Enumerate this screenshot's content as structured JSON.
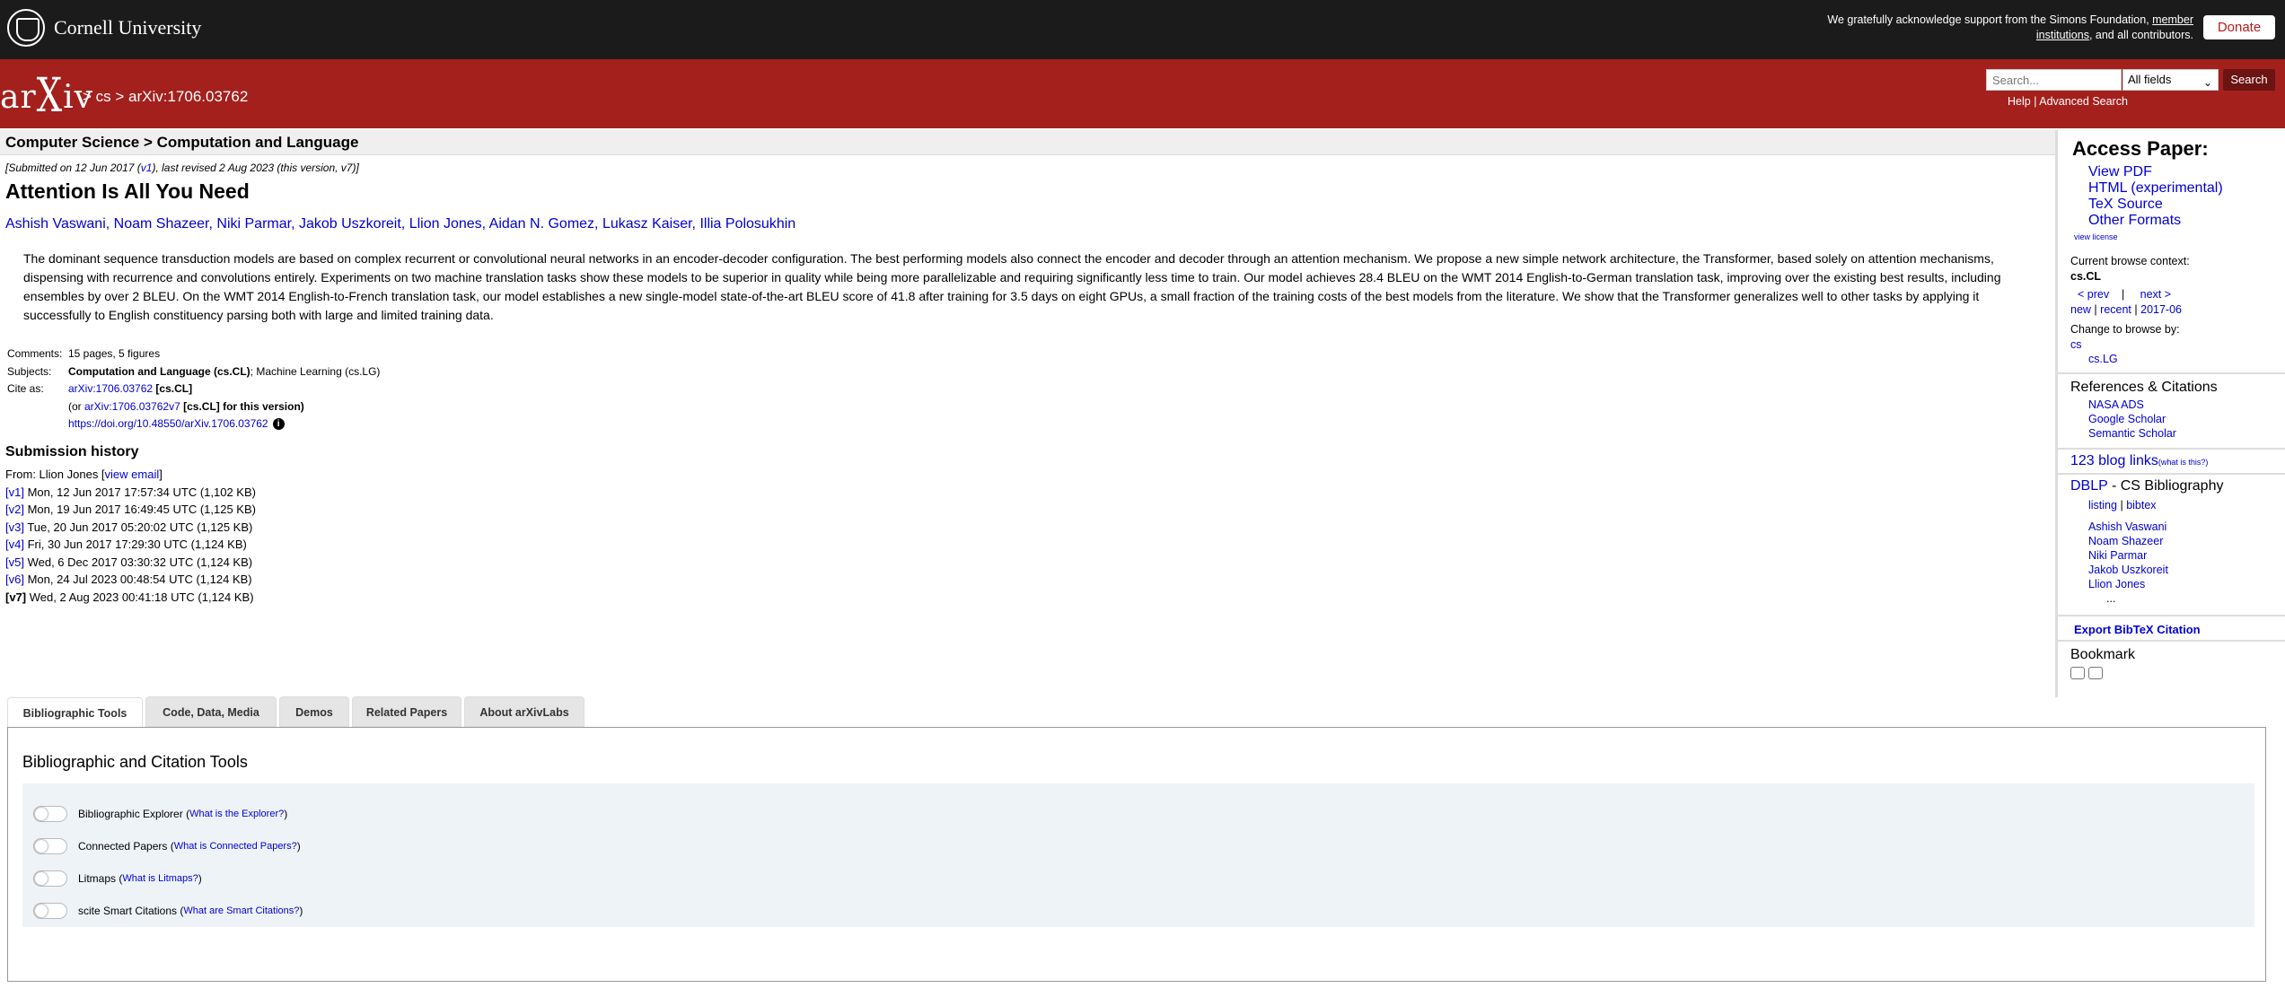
{
  "top": {
    "institution": "Cornell University",
    "support_prefix": "We gratefully acknowledge support from the Simons Foundation, ",
    "support_link": "member institutions",
    "support_suffix": ", and all contributors.",
    "donate_label": "Donate"
  },
  "header": {
    "logo_a": "ar",
    "logo_x": "X",
    "logo_b": "iv",
    "breadcrumb": "> cs > arXiv:1706.03762",
    "search_placeholder": "Search...",
    "search_field": "All fields",
    "search_button": "Search",
    "help": "Help",
    "separator": "|",
    "advanced": "Advanced Search"
  },
  "paper": {
    "category": "Computer Science > Computation and Language",
    "submitted_a": "[Submitted on 12 Jun 2017 (",
    "submitted_v1": "v1",
    "submitted_b": "), last revised 2 Aug 2023 (this version, v7)]",
    "title": "Attention Is All You Need",
    "authors": [
      "Ashish Vaswani",
      "Noam Shazeer",
      "Niki Parmar",
      "Jakob Uszkoreit",
      "Llion Jones",
      "Aidan N. Gomez",
      "Lukasz Kaiser",
      "Illia Polosukhin"
    ],
    "abstract": "The dominant sequence transduction models are based on complex recurrent or convolutional neural networks in an encoder-decoder configuration. The best performing models also connect the encoder and decoder through an attention mechanism. We propose a new simple network architecture, the Transformer, based solely on attention mechanisms, dispensing with recurrence and convolutions entirely. Experiments on two machine translation tasks show these models to be superior in quality while being more parallelizable and requiring significantly less time to train. Our model achieves 28.4 BLEU on the WMT 2014 English-to-German translation task, improving over the existing best results, including ensembles by over 2 BLEU. On the WMT 2014 English-to-French translation task, our model establishes a new single-model state-of-the-art BLEU score of 41.8 after training for 3.5 days on eight GPUs, a small fraction of the training costs of the best models from the literature. We show that the Transformer generalizes well to other tasks by applying it successfully to English constituency parsing both with large and limited training data.",
    "comments_label": "Comments:",
    "comments": "15 pages, 5 figures",
    "subjects_label": "Subjects:",
    "subjects_primary": "Computation and Language (cs.CL)",
    "subjects_rest": "; Machine Learning (cs.LG)",
    "cite_label": "Cite as:",
    "cite_id": "arXiv:1706.03762",
    "cite_cat": "[cs.CL]",
    "cite_or": "(or ",
    "cite_version": "arXiv:1706.03762v7",
    "cite_version_tail": "[cs.CL] for this version)",
    "doi": "https://doi.org/10.48550/arXiv.1706.03762",
    "info_glyph": "i"
  },
  "history": {
    "title": "Submission history",
    "from": "From: Llion Jones [",
    "view_email": "view email",
    "from_close": "]",
    "versions": [
      {
        "v": "[v1]",
        "text": " Mon, 12 Jun 2017 17:57:34 UTC (1,102 KB)"
      },
      {
        "v": "[v2]",
        "text": " Mon, 19 Jun 2017 16:49:45 UTC (1,125 KB)"
      },
      {
        "v": "[v3]",
        "text": " Tue, 20 Jun 2017 05:20:02 UTC (1,125 KB)"
      },
      {
        "v": "[v4]",
        "text": " Fri, 30 Jun 2017 17:29:30 UTC (1,124 KB)"
      },
      {
        "v": "[v5]",
        "text": " Wed, 6 Dec 2017 03:30:32 UTC (1,124 KB)"
      },
      {
        "v": "[v6]",
        "text": " Mon, 24 Jul 2023 00:48:54 UTC (1,124 KB)"
      },
      {
        "v": "[v7]",
        "text": " Wed, 2 Aug 2023 00:41:18 UTC (1,124 KB)"
      }
    ]
  },
  "sidebar": {
    "access_title": "Access Paper:",
    "access_links": [
      "View PDF",
      "HTML (experimental)",
      "TeX Source",
      "Other Formats"
    ],
    "view_license": "view license",
    "browse_context_label": "Current browse context:",
    "browse_context": "cs.CL",
    "prev": "< prev",
    "pipe": "|",
    "next": "next >",
    "new": "new",
    "recent": "recent",
    "month": "2017-06",
    "change_browse": "Change to browse by:",
    "browse_cs": "cs",
    "browse_lg": "cs.LG",
    "refs_title": "References & Citations",
    "refs": [
      "NASA ADS",
      "Google Scholar",
      "Semantic Scholar"
    ],
    "blog_links": "123 blog links",
    "what_is_this": "(what is this?)",
    "dblp": "DBLP",
    "dblp_tail": " - CS Bibliography",
    "listing": "listing",
    "bibtex": "bibtex",
    "dblp_authors": [
      "Ashish Vaswani",
      "Noam Shazeer",
      "Niki Parmar",
      "Jakob Uszkoreit",
      "Llion Jones"
    ],
    "ellipsis": "...",
    "export": "Export BibTeX Citation",
    "bookmark": "Bookmark"
  },
  "tabs": [
    "Bibliographic Tools",
    "Code, Data, Media",
    "Demos",
    "Related Papers",
    "About arXivLabs"
  ],
  "panel": {
    "title": "Bibliographic and Citation Tools",
    "tools": [
      {
        "name": "Bibliographic Explorer",
        "q": "What is the Explorer?"
      },
      {
        "name": "Connected Papers",
        "q": "What is Connected Papers?"
      },
      {
        "name": "Litmaps",
        "q": "What is Litmaps?"
      },
      {
        "name": "scite Smart Citations",
        "q": "What are Smart Citations?"
      }
    ]
  }
}
